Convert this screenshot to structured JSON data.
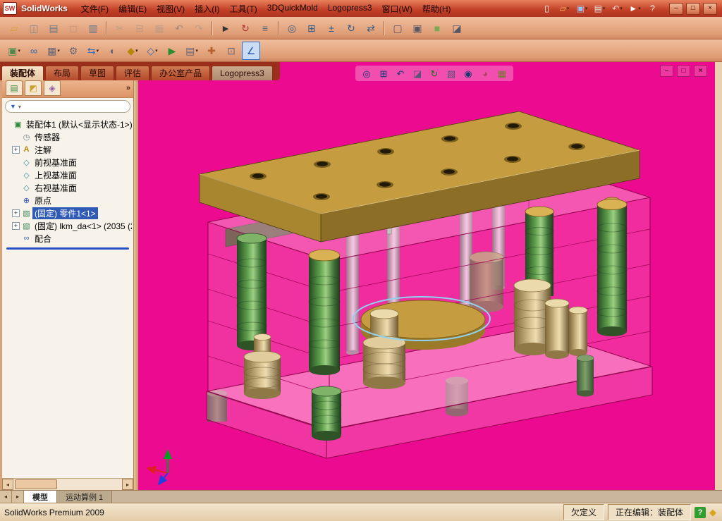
{
  "titlebar": {
    "logo_text": "SW",
    "title": "SolidWorks",
    "icons": [
      {
        "name": "new-document",
        "glyph": "▯",
        "color": "#FFFFFF"
      },
      {
        "name": "open",
        "glyph": "▱",
        "color": "#F0C060",
        "dropdown": true
      },
      {
        "name": "save",
        "glyph": "▣",
        "color": "#9FC3E8",
        "dropdown": true
      },
      {
        "name": "print",
        "glyph": "▤",
        "color": "#E8E8E8",
        "dropdown": true
      },
      {
        "name": "undo",
        "glyph": "↶",
        "color": "#FFD0D0",
        "dropdown": true
      },
      {
        "name": "select",
        "glyph": "►",
        "color": "#FFFFFF",
        "dropdown": true
      },
      {
        "name": "help",
        "glyph": "?",
        "color": "#FFFFFF"
      }
    ],
    "window_buttons": [
      {
        "name": "app-minimize",
        "glyph": "–"
      },
      {
        "name": "app-restore",
        "glyph": "□"
      },
      {
        "name": "app-close",
        "glyph": "×"
      }
    ]
  },
  "menus": [
    "文件(F)",
    "编辑(E)",
    "视图(V)",
    "插入(I)",
    "工具(T)",
    "3DQuickMold",
    "Logopress3",
    "窗口(W)",
    "帮助(H)"
  ],
  "toolbars": {
    "row1": [
      {
        "name": "open-document",
        "glyph": "▱",
        "color": "#D8A030"
      },
      {
        "name": "publish-edrawings",
        "glyph": "◫",
        "color": "#888888"
      },
      {
        "name": "print",
        "glyph": "▤",
        "color": "#667788"
      },
      {
        "name": "print-preview",
        "glyph": "◻",
        "color": "#667788",
        "disabled": true
      },
      {
        "name": "page-setup",
        "glyph": "▥",
        "color": "#667788"
      },
      {
        "sep": true
      },
      {
        "name": "cut",
        "glyph": "✂",
        "color": "#888888",
        "disabled": true
      },
      {
        "name": "copy",
        "glyph": "⊟",
        "color": "#888888",
        "disabled": true
      },
      {
        "name": "paste",
        "glyph": "▦",
        "color": "#888888",
        "disabled": true
      },
      {
        "name": "undo",
        "glyph": "↶",
        "color": "#2255AA",
        "disabled": true
      },
      {
        "name": "redo",
        "glyph": "↷",
        "color": "#888888",
        "disabled": true
      },
      {
        "sep": true
      },
      {
        "name": "select",
        "glyph": "►",
        "color": "#333333"
      },
      {
        "name": "rebuild",
        "glyph": "↻",
        "color": "#AA3333"
      },
      {
        "name": "file-properties",
        "glyph": "≡",
        "color": "#556677"
      },
      {
        "sep": true
      },
      {
        "name": "zoom-to-fit",
        "glyph": "◎",
        "color": "#335C85"
      },
      {
        "name": "zoom-to-area",
        "glyph": "⊞",
        "color": "#335C85"
      },
      {
        "name": "zoom-in-out",
        "glyph": "±",
        "color": "#335C85"
      },
      {
        "name": "rotate-view",
        "glyph": "↻",
        "color": "#335C85"
      },
      {
        "name": "pan",
        "glyph": "⇄",
        "color": "#335C85"
      },
      {
        "sep": true
      },
      {
        "name": "wireframe-display",
        "glyph": "▢",
        "color": "#555566"
      },
      {
        "name": "hidden-lines-visible",
        "glyph": "▣",
        "color": "#555566"
      },
      {
        "name": "shaded-display",
        "glyph": "■",
        "color": "#77AA55"
      },
      {
        "name": "section-view",
        "glyph": "◪",
        "color": "#555566"
      }
    ],
    "row2": [
      {
        "name": "insert-components",
        "glyph": "▣",
        "color": "#4C8A4C",
        "dropdown": true
      },
      {
        "name": "mate",
        "glyph": "∞",
        "color": "#3C6EB4"
      },
      {
        "name": "linear-component-pattern",
        "glyph": "▦",
        "color": "#666677",
        "dropdown": true
      },
      {
        "name": "smart-fasteners",
        "glyph": "⚙",
        "color": "#666677"
      },
      {
        "name": "move-component",
        "glyph": "⇆",
        "color": "#3C6EB4",
        "dropdown": true
      },
      {
        "name": "show-hidden-components",
        "glyph": "◐",
        "color": "#666677"
      },
      {
        "name": "assembly-features",
        "glyph": "◆",
        "color": "#B8860B",
        "dropdown": true
      },
      {
        "name": "reference-geometry",
        "glyph": "◇",
        "color": "#3C6EB4",
        "dropdown": true
      },
      {
        "name": "new-motion-study",
        "glyph": "▶",
        "color": "#2E8B2E"
      },
      {
        "name": "bill-of-materials",
        "glyph": "▤",
        "color": "#666677",
        "dropdown": true
      },
      {
        "name": "exploded-view",
        "glyph": "✚",
        "color": "#B8602A"
      },
      {
        "name": "interference-detection",
        "glyph": "⊡",
        "color": "#666677"
      },
      {
        "name": "measure",
        "glyph": "∠",
        "color": "#2255AA",
        "active": true
      }
    ]
  },
  "command_tabs": [
    {
      "label": "装配体",
      "active": true
    },
    {
      "label": "布局",
      "active": false
    },
    {
      "label": "草图",
      "active": false
    },
    {
      "label": "评估",
      "active": false
    },
    {
      "label": "办公室产品",
      "active": false
    },
    {
      "label": "Logopress3",
      "active": false
    }
  ],
  "left_panel": {
    "header_icons": [
      {
        "name": "featuremanager-tab",
        "glyph": "▤",
        "color": "#3C8A3C"
      },
      {
        "name": "propertymanager-tab",
        "glyph": "◩",
        "color": "#C8A030"
      },
      {
        "name": "configurationmanager-tab",
        "glyph": "◈",
        "color": "#9060A0"
      }
    ]
  },
  "tree": {
    "root": {
      "label": "装配体1 (默认<显示状态-1>)",
      "icon": "assembly"
    },
    "items": [
      {
        "label": "传感器",
        "icon": "sensors"
      },
      {
        "label": "注解",
        "icon": "annotations",
        "expandable": true
      },
      {
        "label": "前视基准面",
        "icon": "plane"
      },
      {
        "label": "上视基准面",
        "icon": "plane"
      },
      {
        "label": "右视基准面",
        "icon": "plane"
      },
      {
        "label": "原点",
        "icon": "origin"
      },
      {
        "label": "(固定) 零件1<1>",
        "icon": "part",
        "expandable": true,
        "selected": true
      },
      {
        "label": "(固定) lkm_da<1> (2035 (2",
        "icon": "part",
        "expandable": true
      },
      {
        "label": "配合",
        "icon": "mates"
      }
    ]
  },
  "viewport": {
    "background_color": "#EC0B90",
    "headsup_icons": [
      {
        "name": "zoom-to-fit",
        "glyph": "◎",
        "color": "#123A6E"
      },
      {
        "name": "zoom-to-area",
        "glyph": "⊞",
        "color": "#123A6E"
      },
      {
        "name": "previous-view",
        "glyph": "↶",
        "color": "#123A6E"
      },
      {
        "name": "section-view",
        "glyph": "◪",
        "color": "#555577"
      },
      {
        "name": "view-orientation",
        "glyph": "↻",
        "color": "#1A6E1A"
      },
      {
        "name": "display-style",
        "glyph": "▧",
        "color": "#555577"
      },
      {
        "name": "hide-show-items",
        "glyph": "◉",
        "color": "#123A6E"
      },
      {
        "name": "edit-appearance",
        "glyph": "◕",
        "color": "#B04060"
      },
      {
        "name": "apply-scene",
        "glyph": "▦",
        "color": "#777733"
      }
    ],
    "doc_window_buttons": [
      {
        "name": "doc-minimize",
        "glyph": "–"
      },
      {
        "name": "doc-restore",
        "glyph": "□"
      },
      {
        "name": "doc-close",
        "glyph": "×"
      }
    ]
  },
  "bottom_tabs": [
    {
      "label": "模型",
      "active": true
    },
    {
      "label": "运动算例 1",
      "active": false
    }
  ],
  "status": {
    "left": "SolidWorks Premium 2009",
    "state": "欠定义",
    "editing": "正在编辑：装配体",
    "help_glyph": "?"
  },
  "icon_glyphs": {
    "expander": "+",
    "panel_overflow": "»",
    "filter_funnel": "▼",
    "dropdown": "▾",
    "panel_collapse": "◀",
    "scroll_left": "◂",
    "scroll_right": "▸",
    "corner": "◆"
  },
  "colors": {
    "titlebar": "#C13F26",
    "toolbar": "#DE9C74",
    "commandmanager_bg": "#9C2F1C",
    "viewport_bg": "#EC0B90",
    "selection_blue": "#2F5BB7",
    "plate_gold": "#C59C40",
    "pillar_green": "#5E9E4C",
    "housing_pink": "#FA8CC8",
    "sketch_highlight": "#8FD2F2"
  }
}
